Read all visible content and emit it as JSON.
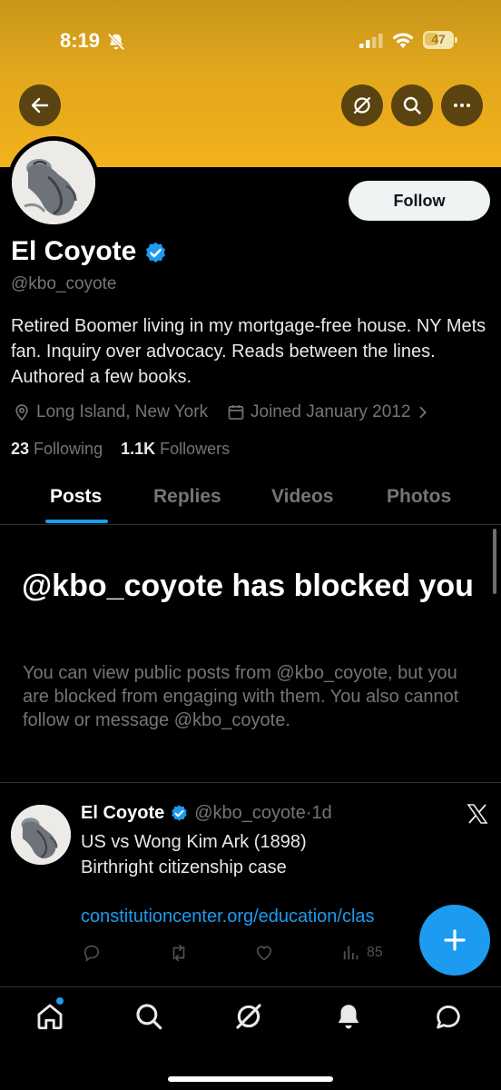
{
  "status_bar": {
    "time": "8:19",
    "battery": "47"
  },
  "header": {
    "back_icon": "arrow-left-icon",
    "grok_icon": "grok-icon",
    "search_icon": "search-icon",
    "more_icon": "more-horizontal-icon"
  },
  "profile": {
    "name": "El Coyote",
    "handle": "@kbo_coyote",
    "follow_label": "Follow",
    "bio": "Retired Boomer living in my mortgage-free house. NY Mets fan. Inquiry over advocacy. Reads between the lines. Authored a few books.",
    "location": "Long Island, New York",
    "joined": "Joined January 2012",
    "following_count": "23",
    "following_label": "Following",
    "followers_count": "1.1K",
    "followers_label": "Followers"
  },
  "tabs": [
    {
      "label": "Posts",
      "active": true
    },
    {
      "label": "Replies",
      "active": false
    },
    {
      "label": "Videos",
      "active": false
    },
    {
      "label": "Photos",
      "active": false
    }
  ],
  "blocked": {
    "title": "@kbo_coyote has blocked you",
    "description": "You can view public posts from @kbo_coyote, but you are blocked from engaging with them. You also cannot follow or message @kbo_coyote."
  },
  "post": {
    "name": "El Coyote",
    "handle": "@kbo_coyote",
    "separator": "·",
    "time": "1d",
    "line1": "US vs Wong Kim Ark (1898)",
    "line2": "Birthright citizenship case",
    "link": "constitutioncenter.org/education/clas",
    "views": "85"
  },
  "colors": {
    "accent": "#1d9bf0",
    "banner": "#f3b21d",
    "background": "#000000"
  }
}
